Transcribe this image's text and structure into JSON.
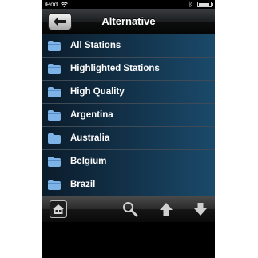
{
  "status_bar": {
    "carrier": "iPod",
    "time": "",
    "icons": [
      "wifi-icon",
      "bluetooth-icon",
      "battery-icon"
    ]
  },
  "nav": {
    "title": "Alternative",
    "back_icon": "arrow-left-icon"
  },
  "list": {
    "items": [
      {
        "label": "All Stations",
        "icon": "folder-icon"
      },
      {
        "label": "Highlighted Stations",
        "icon": "folder-icon"
      },
      {
        "label": "High Quality",
        "icon": "folder-icon"
      },
      {
        "label": "Argentina",
        "icon": "folder-icon"
      },
      {
        "label": "Australia",
        "icon": "folder-icon"
      },
      {
        "label": "Belgium",
        "icon": "folder-icon"
      },
      {
        "label": "Brazil",
        "icon": "folder-icon"
      }
    ]
  },
  "toolbar": {
    "icons": [
      "home-icon",
      "search-icon",
      "arrow-up-icon",
      "arrow-down-icon"
    ]
  },
  "colors": {
    "row_gradient_start": "#0b1c2b",
    "row_gradient_end": "#1a4a6a",
    "folder": "#7db3e6"
  }
}
